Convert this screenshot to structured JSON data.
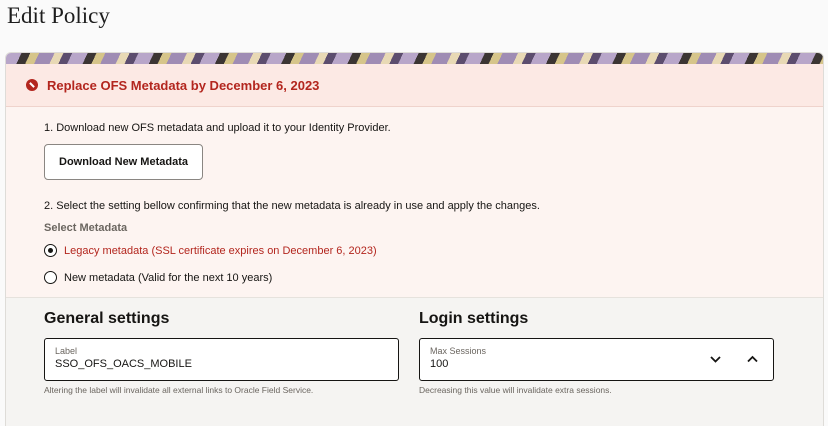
{
  "page": {
    "title": "Edit Policy"
  },
  "alert": {
    "title": "Replace OFS Metadata by December 6, 2023",
    "step1": "1.  Download new OFS metadata and upload it to your Identity Provider.",
    "download_button": "Download New Metadata",
    "step2": "2.  Select the setting bellow confirming that the new metadata is already in use and apply the changes.",
    "select_label": "Select Metadata",
    "options": [
      {
        "label": "Legacy metadata (SSL certificate expires on December 6, 2023)",
        "selected": true
      },
      {
        "label": "New metadata (Valid for the next 10 years)",
        "selected": false
      }
    ],
    "accent_color": "#b3261e"
  },
  "general": {
    "title": "General settings",
    "label_field": {
      "label": "Label",
      "value": "SSO_OFS_OACS_MOBILE"
    },
    "help": "Altering the label will invalidate all external links to Oracle Field Service."
  },
  "login": {
    "title": "Login settings",
    "max_sessions": {
      "label": "Max Sessions",
      "value": "100"
    },
    "help": "Decreasing this value will invalidate extra sessions.",
    "icons": [
      "chevron-down-icon",
      "chevron-up-icon"
    ]
  }
}
